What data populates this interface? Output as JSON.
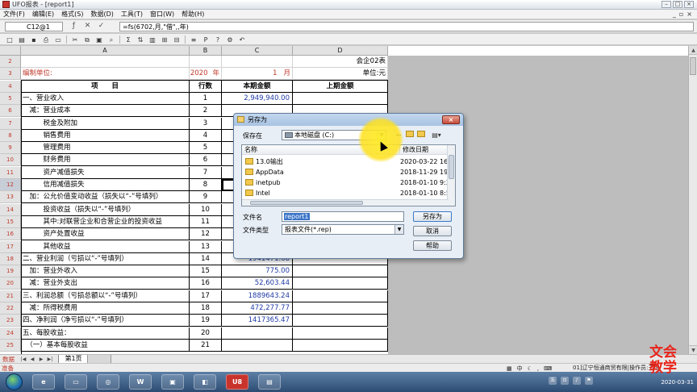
{
  "window": {
    "title": "UFO报表 - [report1]"
  },
  "menu": [
    "文件(F)",
    "编辑(E)",
    "格式(S)",
    "数据(D)",
    "工具(T)",
    "窗口(W)",
    "帮助(H)"
  ],
  "formula_bar": {
    "cell_ref": "C12@1",
    "formula": "=fs(6702,月,\"借\",,年)"
  },
  "sheet": {
    "columns": [
      "A",
      "B",
      "C",
      "D"
    ],
    "top_right_label": "会企02表",
    "header_row": {
      "company_label": "编制单位:",
      "year": "2020",
      "year_unit": "年",
      "month": "1",
      "month_unit": "月",
      "unit": "单位:元"
    },
    "table_headers": {
      "item": "项　　目",
      "line_no": "行数",
      "current": "本期金额",
      "previous": "上期金额"
    },
    "rows": [
      {
        "row_no": "5",
        "item": "一、营业收入",
        "line_no": "1",
        "current": "2,949,940.00"
      },
      {
        "row_no": "6",
        "item": "　减：营业成本",
        "line_no": "2",
        "current": ""
      },
      {
        "row_no": "7",
        "item": "　　　税金及附加",
        "line_no": "3",
        "current": ""
      },
      {
        "row_no": "8",
        "item": "　　　销售费用",
        "line_no": "4",
        "current": ""
      },
      {
        "row_no": "9",
        "item": "　　　管理费用",
        "line_no": "5",
        "current": ""
      },
      {
        "row_no": "10",
        "item": "　　　财务费用",
        "line_no": "6",
        "current": ""
      },
      {
        "row_no": "11",
        "item": "　　　资产减值损失",
        "line_no": "7",
        "current": ""
      },
      {
        "row_no": "12",
        "item": "　　　信用减值损失",
        "line_no": "8",
        "current": ""
      },
      {
        "row_no": "13",
        "item": "　加：公允价值变动收益（损失以“-”号填列）",
        "line_no": "9",
        "current": ""
      },
      {
        "row_no": "14",
        "item": "　　　投资收益（损失以“-”号填列）",
        "line_no": "10",
        "current": ""
      },
      {
        "row_no": "15",
        "item": "　　　其中:对联营企业和合营企业的投资收益",
        "line_no": "11",
        "current": ""
      },
      {
        "row_no": "16",
        "item": "　　　资产处置收益",
        "line_no": "12",
        "current": ""
      },
      {
        "row_no": "17",
        "item": "　　　其他收益",
        "line_no": "13",
        "current": ""
      },
      {
        "row_no": "18",
        "item": "二、营业利润（亏损以“-”号填列）",
        "line_no": "14",
        "current": "1941471.68"
      },
      {
        "row_no": "19",
        "item": "　加：营业外收入",
        "line_no": "15",
        "current": "775.00"
      },
      {
        "row_no": "20",
        "item": "　减：营业外支出",
        "line_no": "16",
        "current": "52,603.44"
      },
      {
        "row_no": "21",
        "item": "三、利润总额（亏损总额以“-”号填列）",
        "line_no": "17",
        "current": "1889643.24"
      },
      {
        "row_no": "22",
        "item": "　减：所得税费用",
        "line_no": "18",
        "current": "472,277.77"
      },
      {
        "row_no": "23",
        "item": "四、净利润（净亏损以“-”号填列）",
        "line_no": "19",
        "current": "1417365.47"
      },
      {
        "row_no": "24",
        "item": "五、每股收益：",
        "line_no": "20",
        "current": ""
      },
      {
        "row_no": "25",
        "item": "　（一）基本每股收益",
        "line_no": "21",
        "current": ""
      }
    ],
    "tab_label": "第1页",
    "mode_label": "数据"
  },
  "status": {
    "left": "准备",
    "lang": "中",
    "right_info": "01]辽宁恒通商贸有限|操作员:王琼"
  },
  "dialog": {
    "title": "另存为",
    "save_in_label": "保存在",
    "save_in_value": "本地磁盘 (C:)",
    "col_name": "名称",
    "col_date": "修改日期",
    "files": [
      {
        "name": "13.0输出",
        "date": "2020-03-22 16:4"
      },
      {
        "name": "AppData",
        "date": "2018-11-29 19:2"
      },
      {
        "name": "inetpub",
        "date": "2018-01-10 9:23"
      },
      {
        "name": "Intel",
        "date": "2018-01-10 8:52"
      }
    ],
    "filename_label": "文件名",
    "filename_value": "report1",
    "filetype_label": "文件类型",
    "filetype_value": "报表文件(*.rep)",
    "save_button": "另存为",
    "cancel_button": "取消",
    "help_button": "帮助"
  },
  "watermark": {
    "line1": "文会",
    "line2": "教学"
  },
  "taskbar": {
    "clock": "2020-03-31"
  }
}
